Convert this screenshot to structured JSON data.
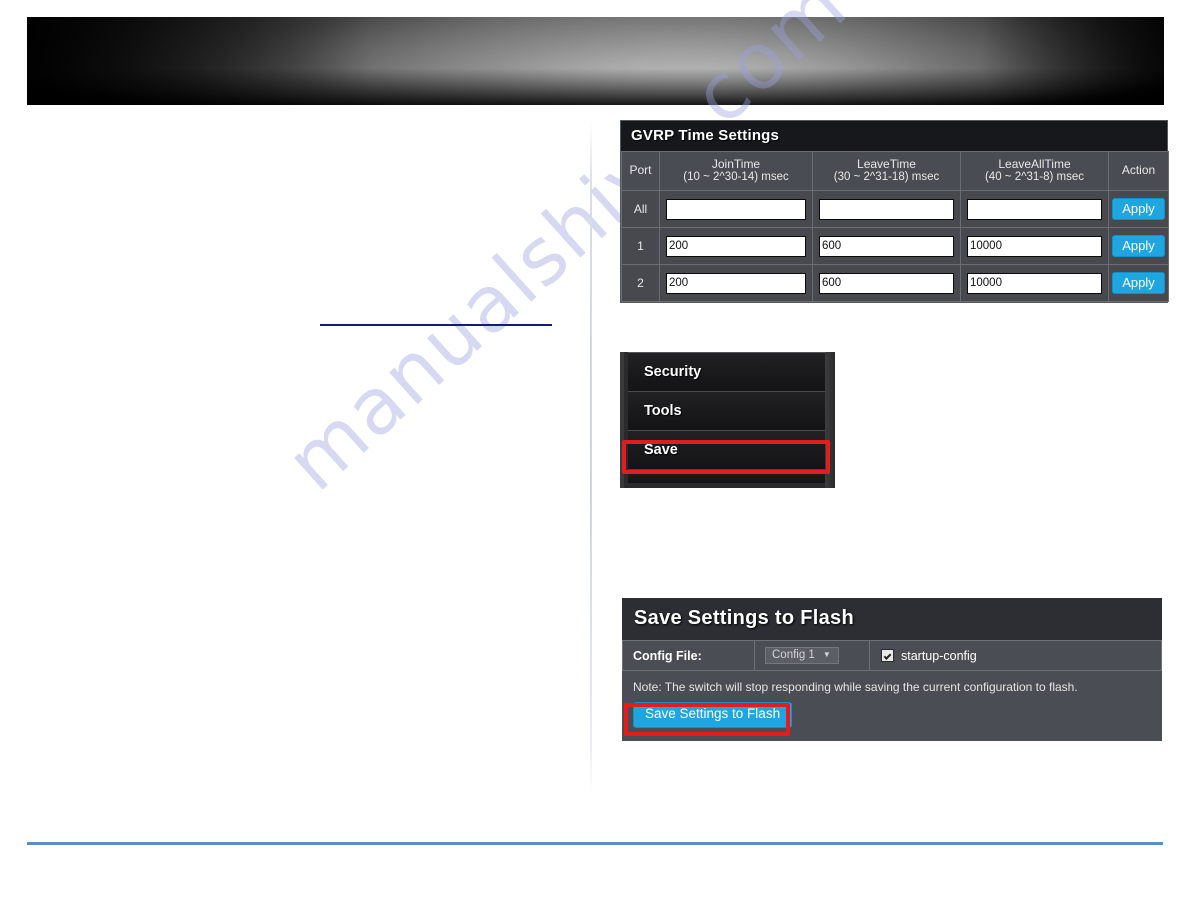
{
  "page": {
    "watermark": "manualshive.com"
  },
  "gvrp_panel": {
    "title": "GVRP Time Settings",
    "columns": [
      {
        "label": "Port",
        "sub": ""
      },
      {
        "label": "JoinTime",
        "sub": "(10 ~ 2^30-14) msec"
      },
      {
        "label": "LeaveTime",
        "sub": "(30 ~ 2^31-18) msec"
      },
      {
        "label": "LeaveAllTime",
        "sub": "(40 ~ 2^31-8) msec"
      },
      {
        "label": "Action",
        "sub": ""
      }
    ],
    "rows": [
      {
        "port": "All",
        "join": "",
        "leave": "",
        "leaveall": "",
        "action": "Apply"
      },
      {
        "port": "1",
        "join": "200",
        "leave": "600",
        "leaveall": "10000",
        "action": "Apply"
      },
      {
        "port": "2",
        "join": "200",
        "leave": "600",
        "leaveall": "10000",
        "action": "Apply"
      }
    ]
  },
  "menu_panel": {
    "items": [
      {
        "label": "Security",
        "highlighted": false
      },
      {
        "label": "Tools",
        "highlighted": false
      },
      {
        "label": "Save",
        "highlighted": true
      }
    ],
    "highlight_color": "#e31d1d"
  },
  "flash_panel": {
    "title": "Save Settings to Flash",
    "config_file_label": "Config File:",
    "config_file_value": "Config 1",
    "checkbox_label": "startup-config",
    "checkbox_checked": true,
    "note": "Note: The switch will stop responding while saving the current configuration to flash.",
    "button_label": "Save Settings to Flash",
    "accent_color": "#1fa6e0",
    "highlight_color": "#e31d1d"
  }
}
